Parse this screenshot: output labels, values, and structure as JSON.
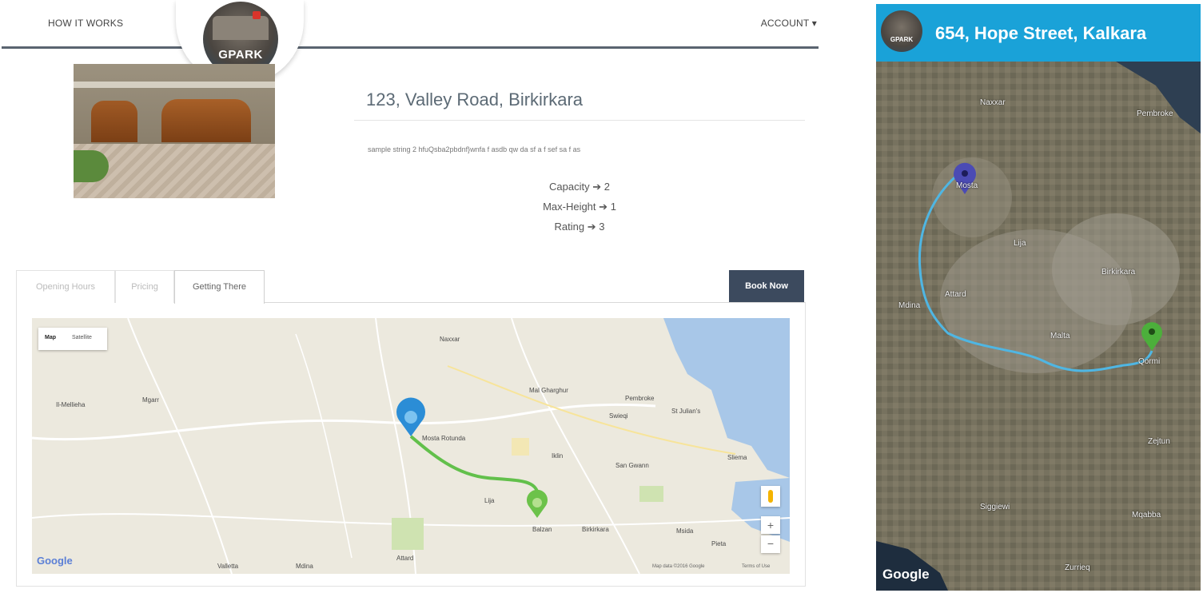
{
  "desktop": {
    "nav": {
      "how_it_works": "HOW IT WORKS",
      "account": "ACCOUNT ▾"
    },
    "logo_text": "GPARK",
    "place": {
      "title": "123, Valley Road, Birkirkara",
      "description": "sample string 2 hfuQsba2pbdnf}wnfa f asdb qw da sf a f sef sa f as",
      "stats": [
        {
          "label": "Capacity",
          "value": "2"
        },
        {
          "label": "Max-Height",
          "value": "1"
        },
        {
          "label": "Rating",
          "value": "3"
        }
      ]
    },
    "tabs": [
      "Opening Hours",
      "Pricing",
      "Getting There"
    ],
    "active_tab": "Getting There",
    "book_now": "Book Now",
    "map": {
      "type_map": "Map",
      "type_satellite": "Satellite",
      "zoom_in": "+",
      "zoom_out": "−",
      "google": "Google",
      "credit": "Map data ©2016 Google",
      "terms": "Terms of Use",
      "labels": [
        "Naxxar",
        "Pembroke",
        "Mgarr",
        "Mal Gharghur",
        "Swieqi",
        "St Julian's",
        "Mosta Rotunda",
        "Iklin",
        "San Gwann",
        "Lija",
        "Balzan",
        "Birkirkara",
        "Attard",
        "Sliema",
        "Mdina",
        "Valletta",
        "Pieta",
        "Msida",
        "Il-Mellieha"
      ],
      "route_color": "#62c04b",
      "start_pin_color": "#2b8dd6",
      "end_pin_color": "#6cc24a"
    }
  },
  "mobile": {
    "header_color": "#1aa2d8",
    "title": "654, Hope Street, Kalkara",
    "logo_text": "GPARK",
    "map": {
      "google": "Google",
      "labels": [
        "Naxxar",
        "Pembroke",
        "Mosta",
        "Lija",
        "Birkirkara",
        "Attard",
        "Mdina",
        "Malta",
        "Qormi",
        "Zejtun",
        "Siggiewi",
        "Mqabba",
        "Zurrieq"
      ],
      "route_color": "#4fb6e3",
      "start_pin_color": "#4b4bb4",
      "end_pin_color": "#4caf3b"
    }
  }
}
